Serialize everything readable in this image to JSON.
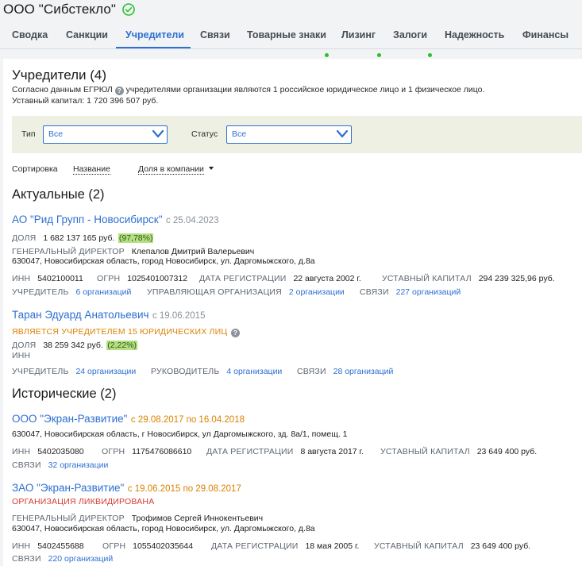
{
  "company": {
    "name": "ООО \"Сибстекло\""
  },
  "tabs": [
    {
      "label": "Сводка"
    },
    {
      "label": "Санкции"
    },
    {
      "label": "Учредители"
    },
    {
      "label": "Связи"
    },
    {
      "label": "Товарные знаки"
    },
    {
      "label": "Лизинг"
    },
    {
      "label": "Залоги"
    },
    {
      "label": "Надежность"
    },
    {
      "label": "Финансы"
    }
  ],
  "section": {
    "title": "Учредители (4)",
    "desc_before": "Согласно данным ЕГРЮЛ",
    "desc_after": "учредителями организации являются 1 российское юридическое лицо и 1 физическое лицо.",
    "capital": "Уставный капитал: 1 720 396 507 руб."
  },
  "filters": {
    "type_label": "Тип",
    "type_value": "Все",
    "status_label": "Статус",
    "status_value": "Все"
  },
  "sort": {
    "label": "Сортировка",
    "by_name": "Название",
    "by_share": "Доля в компании"
  },
  "current": {
    "title": "Актуальные (2)",
    "items": [
      {
        "name": "АО \"Рид Групп - Новосибирск\"",
        "since": "с 25.04.2023",
        "share_label": "ДОЛЯ",
        "share": "1 682 137 165 руб.",
        "pct": "(97,78%)",
        "director_label": "ГЕНЕРАЛЬНЫЙ ДИРЕКТОР",
        "director": "Клепалов Дмитрий Валерьевич",
        "address": "630047, Новосибирская область, город Новосибирск, ул. Даргомыжского, д.8а",
        "inn_label": "ИНН",
        "inn": "5402100011",
        "ogrn_label": "ОГРН",
        "ogrn": "1025401007312",
        "reg_label": "ДАТА РЕГИСТРАЦИИ",
        "reg": "22 августа 2002 г.",
        "capital_label": "УСТАВНЫЙ КАПИТАЛ",
        "capital": "294 239 325,96 руб.",
        "founder_label": "УЧРЕДИТЕЛЬ",
        "founder": "6 организаций",
        "mgmt_label": "УПРАВЛЯЮЩАЯ ОРГАНИЗАЦИЯ",
        "mgmt": "2 организации",
        "links_label": "СВЯЗИ",
        "links": "227 организаций"
      },
      {
        "name": "Таран Эдуард Анатольевич",
        "since": "с 19.06.2015",
        "note": "ЯВЛЯЕТСЯ УЧРЕДИТЕЛЕМ 15 ЮРИДИЧЕСКИХ ЛИЦ",
        "share_label": "ДОЛЯ",
        "share": "38 259 342 руб.",
        "pct": "(2,22%)",
        "inn_label": "ИНН",
        "founder_label": "УЧРЕДИТЕЛЬ",
        "founder": "24 организации",
        "head_label": "РУКОВОДИТЕЛЬ",
        "head": "4 организации",
        "links_label": "СВЯЗИ",
        "links": "28 организаций"
      }
    ]
  },
  "historical": {
    "title": "Исторические (2)",
    "items": [
      {
        "name": "ООО \"Экран-Развитие\"",
        "period": "с 29.08.2017 по 16.04.2018",
        "address": "630047, Новосибирская область, г Новосибирск, ул Даргомыжского, зд. 8а/1, помещ. 1",
        "inn_label": "ИНН",
        "inn": "5402035080",
        "ogrn_label": "ОГРН",
        "ogrn": "1175476086610",
        "reg_label": "ДАТА РЕГИСТРАЦИИ",
        "reg": "8 августа 2017 г.",
        "capital_label": "УСТАВНЫЙ КАПИТАЛ",
        "capital": "23 649 400 руб.",
        "links_label": "СВЯЗИ",
        "links": "32 организации"
      },
      {
        "name": "ЗАО \"Экран-Развитие\"",
        "period": "с 19.06.2015 по 29.08.2017",
        "status": "ОРГАНИЗАЦИЯ ЛИКВИДИРОВАНА",
        "director_label": "ГЕНЕРАЛЬНЫЙ ДИРЕКТОР",
        "director": "Трофимов Сергей Иннокентьевич",
        "address": "630047, Новосибирская область, город Новосибирск, ул. Даргомыжского, д.8а",
        "inn_label": "ИНН",
        "inn": "5402455688",
        "ogrn_label": "ОГРН",
        "ogrn": "1055402035644",
        "reg_label": "ДАТА РЕГИСТРАЦИИ",
        "reg": "18 мая 2005 г.",
        "capital_label": "УСТАВНЫЙ КАПИТАЛ",
        "capital": "23 649 400 руб.",
        "links_label": "СВЯЗИ",
        "links": "220 организаций"
      }
    ]
  },
  "colors": {
    "accent": "#2e6fd1",
    "ok": "#27c22f",
    "warn": "#d98200",
    "danger": "#d63a2f",
    "share_bg": "#b6df83"
  }
}
